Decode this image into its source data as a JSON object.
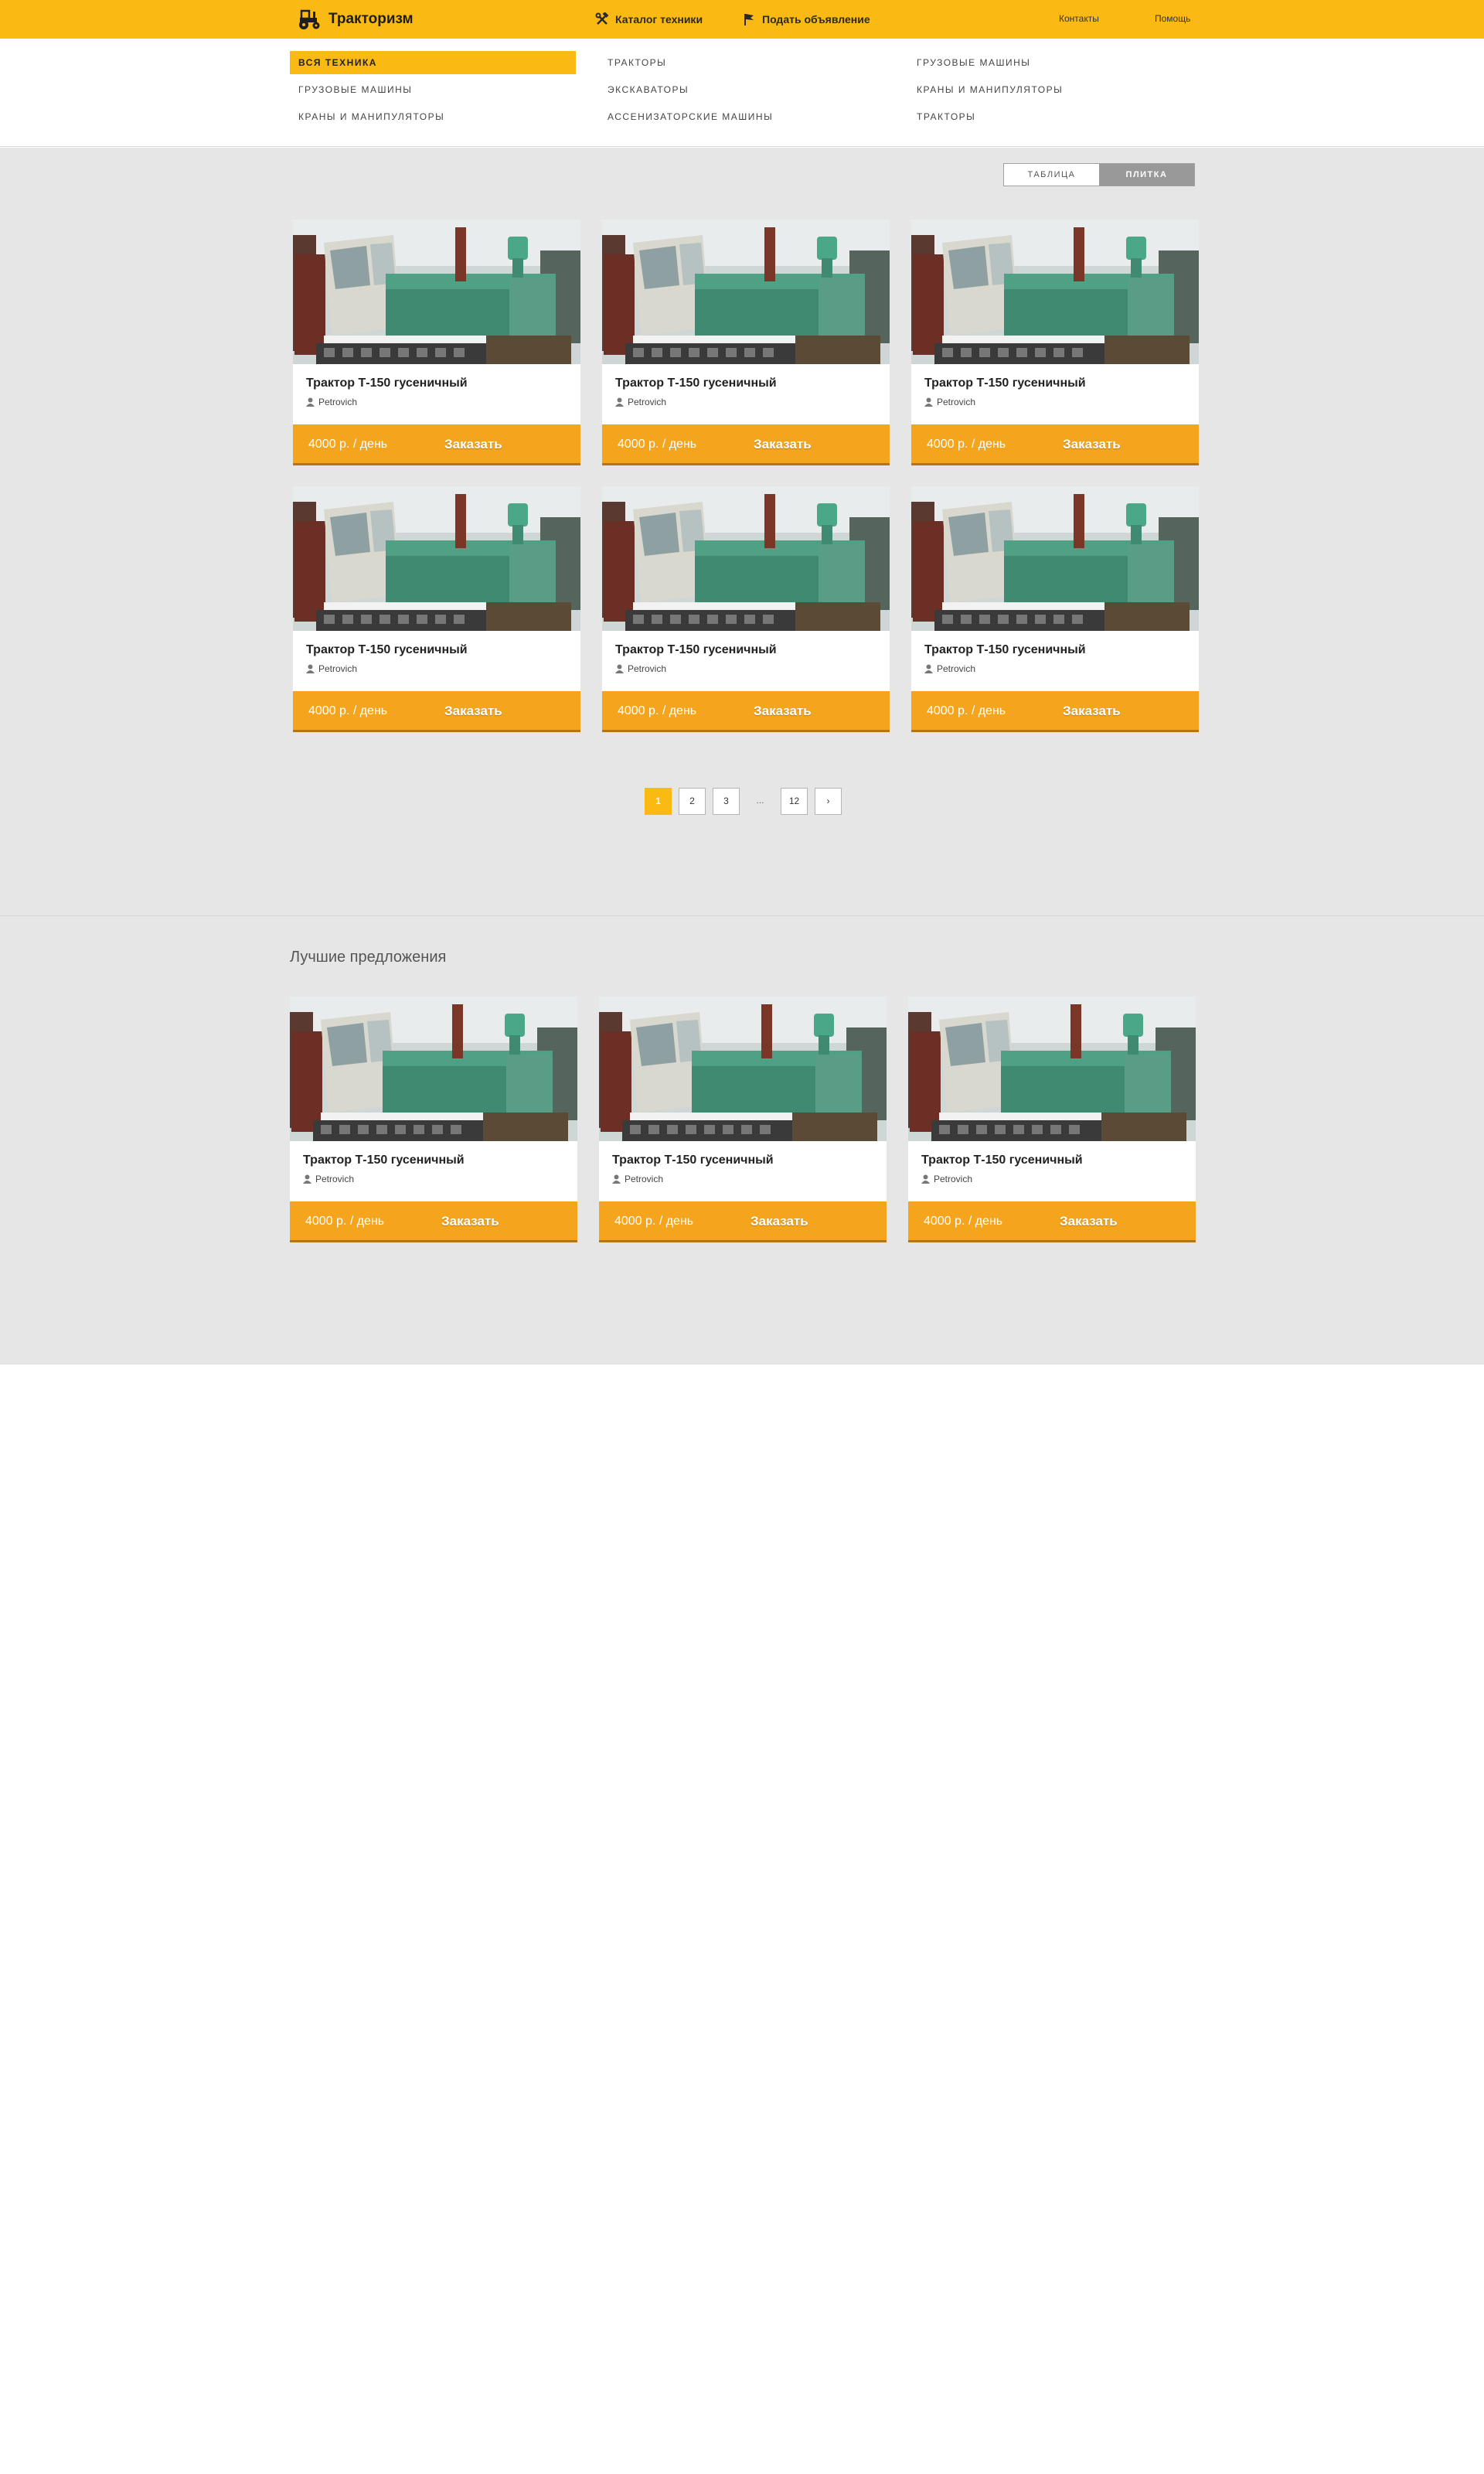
{
  "header": {
    "logo_text": "Тракторизм",
    "nav": {
      "catalog": "Каталог техники",
      "post_ad": "Подать объявление"
    },
    "right": {
      "contacts": "Контакты",
      "help": "Помощь"
    }
  },
  "categories": [
    "Вся техника",
    "Тракторы",
    "Грузовые машины",
    "Грузовые машины",
    "Экскаваторы",
    "Краны и манипуляторы",
    "Краны и манипуляторы",
    "Ассенизаторские машины",
    "Тракторы"
  ],
  "view_toggle": {
    "table": "Таблица",
    "tile": "Плитка"
  },
  "listings": [
    {
      "title": "Трактор Т-150 гусеничный",
      "author": "Petrovich",
      "price": "4000 р. / день",
      "order": "Заказать"
    },
    {
      "title": "Трактор Т-150 гусеничный",
      "author": "Petrovich",
      "price": "4000 р. / день",
      "order": "Заказать"
    },
    {
      "title": "Трактор Т-150 гусеничный",
      "author": "Petrovich",
      "price": "4000 р. / день",
      "order": "Заказать"
    },
    {
      "title": "Трактор Т-150 гусеничный",
      "author": "Petrovich",
      "price": "4000 р. / день",
      "order": "Заказать"
    },
    {
      "title": "Трактор Т-150 гусеничный",
      "author": "Petrovich",
      "price": "4000 р. / день",
      "order": "Заказать"
    },
    {
      "title": "Трактор Т-150 гусеничный",
      "author": "Petrovich",
      "price": "4000 р. / день",
      "order": "Заказать"
    }
  ],
  "pagination": [
    "1",
    "2",
    "3",
    "...",
    "12",
    "›"
  ],
  "best_offers": {
    "title": "Лучшие предложения",
    "items": [
      {
        "title": "Трактор Т-150 гусеничный",
        "author": "Petrovich",
        "price": "4000 р. / день",
        "order": "Заказать"
      },
      {
        "title": "Трактор Т-150 гусеничный",
        "author": "Petrovich",
        "price": "4000 р. / день",
        "order": "Заказать"
      },
      {
        "title": "Трактор Т-150 гусеничный",
        "author": "Petrovich",
        "price": "4000 р. / день",
        "order": "Заказать"
      }
    ]
  },
  "colors": {
    "brand_yellow": "#fbb914",
    "order_bar": "#f5a51d",
    "background_grey": "#e6e6e6"
  }
}
